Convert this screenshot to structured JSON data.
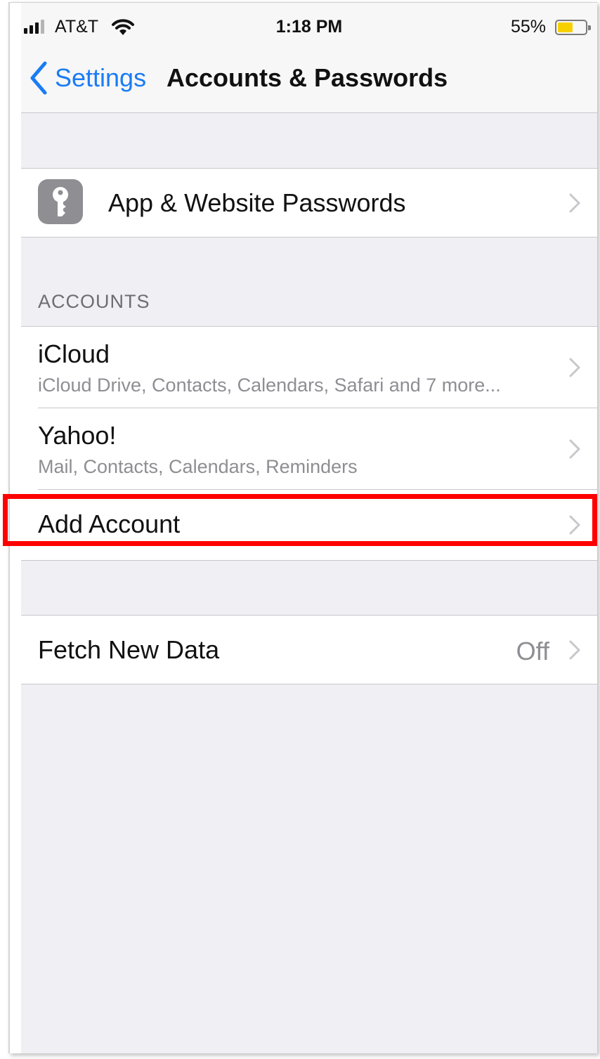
{
  "status_bar": {
    "carrier": "AT&T",
    "time": "1:18 PM",
    "battery_percent": "55%",
    "battery_level": 0.55,
    "battery_color": "#f7d000"
  },
  "nav": {
    "back_label": "Settings",
    "title": "Accounts & Passwords"
  },
  "passwords_row": {
    "icon": "key-icon",
    "label": "App & Website Passwords"
  },
  "accounts": {
    "header": "ACCOUNTS",
    "items": [
      {
        "title": "iCloud",
        "subtitle": "iCloud Drive, Contacts, Calendars, Safari and 7 more..."
      },
      {
        "title": "Yahoo!",
        "subtitle": "Mail, Contacts, Calendars, Reminders"
      }
    ],
    "add_label": "Add Account"
  },
  "fetch": {
    "label": "Fetch New Data",
    "value": "Off"
  },
  "colors": {
    "accent": "#1a7cf5",
    "highlight": "#ff0000",
    "background": "#efeff4"
  }
}
